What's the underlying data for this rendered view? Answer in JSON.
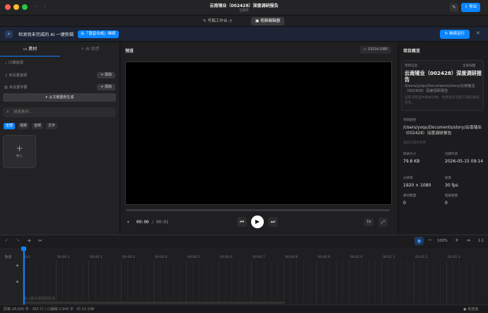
{
  "window": {
    "title": "云南锗业（002428）深度调研报告",
    "subtitle": "已保存",
    "export_label": "导出"
  },
  "tabs": [
    {
      "label": "写稿工作台"
    },
    {
      "label": "视频编辑器"
    }
  ],
  "banner": {
    "text": "检测到未完成的 AI 一键剪辑",
    "badge": "从「语音合成」继续",
    "continue_label": "继续运行"
  },
  "left": {
    "tabs": [
      {
        "label": "素材"
      },
      {
        "label": "AI 助手"
      }
    ],
    "section_title": "口播音源",
    "audio_label": "未设置音频",
    "subtitle_label": "未设置字幕",
    "add_label": "+ 添加",
    "regenerate_label": "从文稿重新生成",
    "search_placeholder": "搜索素材...",
    "filters": [
      {
        "label": "全部"
      },
      {
        "label": "视频"
      },
      {
        "label": "音频"
      },
      {
        "label": "文字"
      }
    ],
    "import_label": "导入"
  },
  "preview": {
    "title": "预览",
    "resolution": "1920x1080",
    "time_current": "00:00",
    "time_sep": "/",
    "time_total": "00:01",
    "speed": "1x"
  },
  "overview": {
    "title": "项目概览",
    "tag": "全局视图",
    "project_label": "项目信息",
    "project_name": "云南锗业（002428）深度调研报告",
    "project_file": "/Users/yoqu/Documents/story/云南锗业（002428）深度调研报告",
    "hint": "当前没有选中具体对象，右侧显示当前工程的基础信息。",
    "path_label": "项目路径",
    "path_value": "/Users/yoqu/Documents/story/云南锗业（002428）深度调研报告",
    "path_note": "当前工程文件夹",
    "stats": [
      {
        "label": "目录大小",
        "value": "79.8 KB"
      },
      {
        "label": "创建时间",
        "value": "2026-05-15 09:14"
      },
      {
        "label": "分辨率",
        "value": "1920 × 1080"
      },
      {
        "label": "帧率",
        "value": "30 fps"
      },
      {
        "label": "素材数量",
        "value": "0"
      },
      {
        "label": "图层数量",
        "value": "0"
      }
    ]
  },
  "timeline": {
    "zoom": "100%",
    "ratio": "1:1",
    "track_label": "轨道",
    "ticks": [
      "0.0",
      "00:00.1",
      "00:00.2",
      "00:00.3",
      "00:00.4",
      "00:00.5",
      "00:00.6",
      "00:00.7",
      "00:00.8",
      "00:00.9",
      "00:01.0",
      "00:01.1",
      "00:01.2",
      "00:01.3"
    ],
    "drop_hint": "拖入图片或视频轨道"
  },
  "status": {
    "left": "原稿 28,990 字 · 363 行 | 口播稿 2,943 字 · 约 10 分钟",
    "right": "未连接"
  },
  "colors": {
    "accent": "#0a84ff",
    "bg": "#1c1c1e",
    "playhead": "#0a84ff"
  }
}
